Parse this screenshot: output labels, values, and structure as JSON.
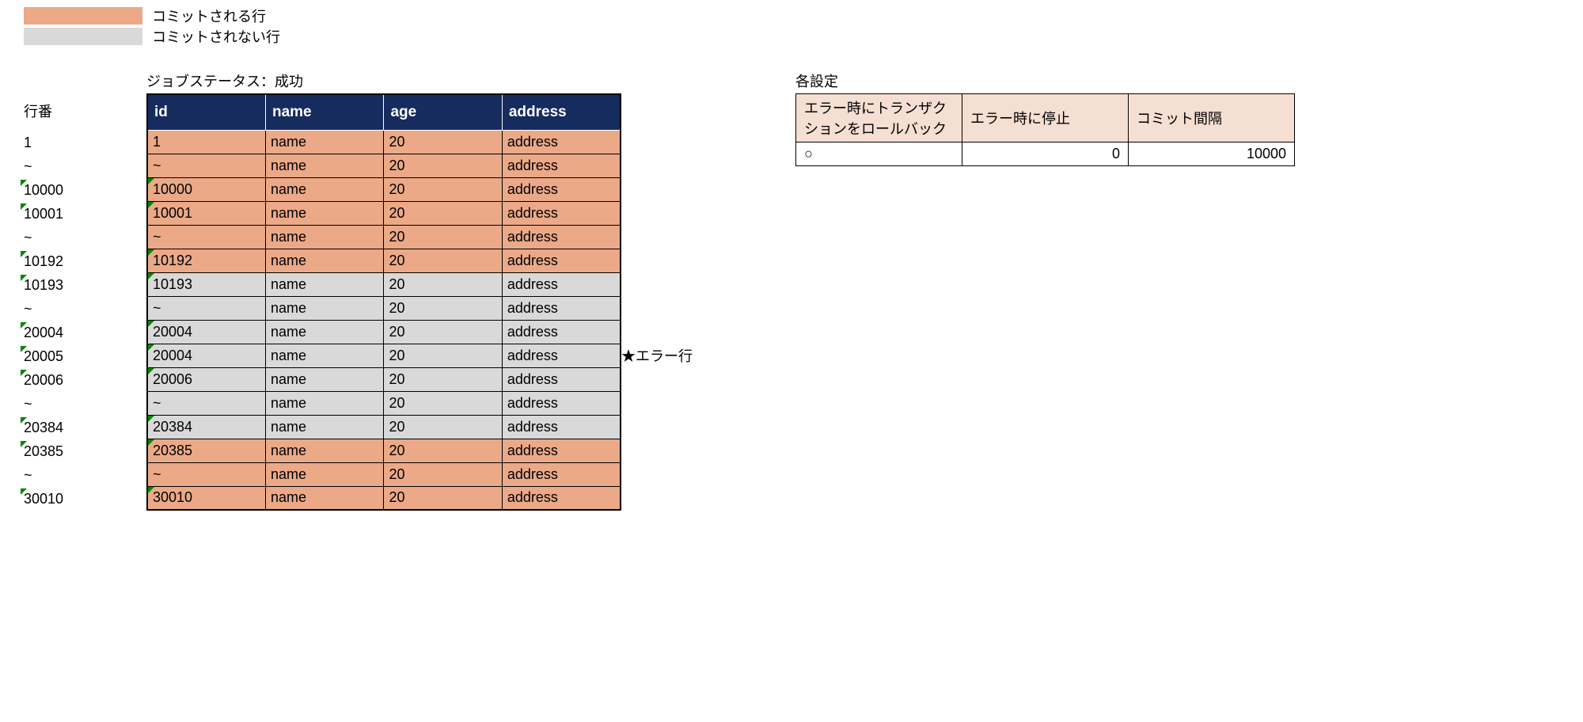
{
  "legend": {
    "committed": "コミットされる行",
    "not_committed": "コミットされない行"
  },
  "rownum_header": "行番",
  "job_status": "ジョブステータス：成功",
  "columns": {
    "id": "id",
    "name": "name",
    "age": "age",
    "address": "address"
  },
  "rows": [
    {
      "rn": "1",
      "tri": false,
      "id": "1",
      "name": "name",
      "age": "20",
      "address": "address",
      "style": "orange",
      "tdtri": false,
      "annot": ""
    },
    {
      "rn": "~",
      "tri": false,
      "id": "~",
      "name": "name",
      "age": "20",
      "address": "address",
      "style": "orange",
      "tdtri": false,
      "annot": ""
    },
    {
      "rn": "10000",
      "tri": true,
      "id": "10000",
      "name": "name",
      "age": "20",
      "address": "address",
      "style": "orange",
      "tdtri": true,
      "annot": ""
    },
    {
      "rn": "10001",
      "tri": true,
      "id": "10001",
      "name": "name",
      "age": "20",
      "address": "address",
      "style": "orange",
      "tdtri": true,
      "annot": ""
    },
    {
      "rn": "~",
      "tri": false,
      "id": "~",
      "name": "name",
      "age": "20",
      "address": "address",
      "style": "orange",
      "tdtri": false,
      "annot": ""
    },
    {
      "rn": "10192",
      "tri": true,
      "id": "10192",
      "name": "name",
      "age": "20",
      "address": "address",
      "style": "orange",
      "tdtri": true,
      "annot": ""
    },
    {
      "rn": "10193",
      "tri": true,
      "id": "10193",
      "name": "name",
      "age": "20",
      "address": "address",
      "style": "gray",
      "tdtri": true,
      "annot": ""
    },
    {
      "rn": "~",
      "tri": false,
      "id": "~",
      "name": "name",
      "age": "20",
      "address": "address",
      "style": "gray",
      "tdtri": false,
      "annot": ""
    },
    {
      "rn": "20004",
      "tri": true,
      "id": "20004",
      "name": "name",
      "age": "20",
      "address": "address",
      "style": "gray",
      "tdtri": true,
      "annot": ""
    },
    {
      "rn": "20005",
      "tri": true,
      "id": "20004",
      "name": "name",
      "age": "20",
      "address": "address",
      "style": "gray",
      "tdtri": true,
      "annot": "★エラー行"
    },
    {
      "rn": "20006",
      "tri": true,
      "id": "20006",
      "name": "name",
      "age": "20",
      "address": "address",
      "style": "gray",
      "tdtri": true,
      "annot": ""
    },
    {
      "rn": "~",
      "tri": false,
      "id": "~",
      "name": "name",
      "age": "20",
      "address": "address",
      "style": "gray",
      "tdtri": false,
      "annot": ""
    },
    {
      "rn": "20384",
      "tri": true,
      "id": "20384",
      "name": "name",
      "age": "20",
      "address": "address",
      "style": "gray",
      "tdtri": true,
      "annot": ""
    },
    {
      "rn": "20385",
      "tri": true,
      "id": "20385",
      "name": "name",
      "age": "20",
      "address": "address",
      "style": "orange",
      "tdtri": true,
      "annot": ""
    },
    {
      "rn": "~",
      "tri": false,
      "id": "~",
      "name": "name",
      "age": "20",
      "address": "address",
      "style": "orange",
      "tdtri": false,
      "annot": ""
    },
    {
      "rn": "30010",
      "tri": true,
      "id": "30010",
      "name": "name",
      "age": "20",
      "address": "address",
      "style": "orange",
      "tdtri": true,
      "annot": ""
    }
  ],
  "settings_title": "各設定",
  "settings": {
    "h1": "エラー時にトランザクションをロールバック",
    "h2": "エラー時に停止",
    "h3": "コミット間隔",
    "v1": "○",
    "v2": "0",
    "v3": "10000"
  }
}
